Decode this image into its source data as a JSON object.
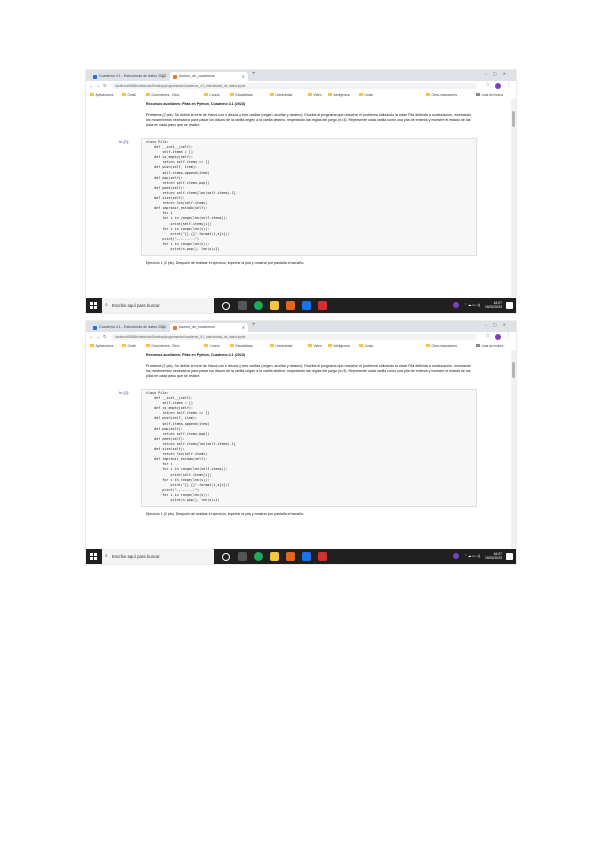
{
  "tabs": [
    {
      "label": "Cuaderno 4.1 - Estructuras de datos 2023"
    },
    {
      "label": "Asesor_de_cuadernos"
    }
  ],
  "url": "localhost:8888/notebooks/Desktop/programacion/cuaderno_4.1_estructuras_de_datos.ipynb",
  "bookmarks": [
    "Aplicaciones",
    "Gmail",
    "Documentos - Educ",
    "Cursos",
    "Estadísticas",
    "Universidad",
    "Video",
    "Inteligencia",
    "Guías"
  ],
  "bookmarks_right": [
    "Otros marcadores",
    "Lista de lectura"
  ],
  "heading": "Recursos auxiliares: Pilas en Python, Cuaderno 4.1 (2023)",
  "problem_text": "Problema (2 pts). Se define la torre de Hanoi con n discos y tres varillas (origen, auxiliar y destino). Escriba el programa que resuelve el problema utilizando la clase Pila definida a continuación, mostrando los movimientos necesarios para pasar los discos de la varilla origen a la varilla destino, respetando las reglas del juego (n=3). Represente cada varilla como una pila de enteros y muestre el estado de las pilas en cada paso que se realice.",
  "cell_prompt": "In [2]:",
  "code_lines": [
    "class Pila:",
    "    def __init__(self):",
    "        self.items = []",
    "    def is_empty(self):",
    "        return self.items == []",
    "    def push(self, item):",
    "        self.items.append(item)",
    "    def pop(self):",
    "        return self.items.pop()",
    "    def peek(self):",
    "        return self.items[len(self.items)-1]",
    "    def size(self):",
    "        return len(self.items)",
    "",
    "    def imprimir_estado(self):",
    "        for i",
    "        for i in range(len(self.items)):",
    "            print(self.items[i])",
    "        for i in range(len(s)):",
    "            print(\"{} {}\".format(i,s[i]))",
    "        print(\"---------\")",
    "        for i in range(len(s)):",
    "            print(s.pop(), len(s)+1)"
  ],
  "exercise_text": "Ejercicio 1 (2 pts). Después de realizar el ejercicio, imprimir la pila y mostrar por pantalla el tamaño.",
  "taskbar": {
    "search_placeholder": "Escribe aquí para buscar",
    "time": "16:07",
    "date": "15/02/2023"
  },
  "colors": {
    "tab_bar": "#dee1e6",
    "taskbar": "#202020",
    "code_background": "#f7f7f7",
    "keyword": "#008000"
  }
}
